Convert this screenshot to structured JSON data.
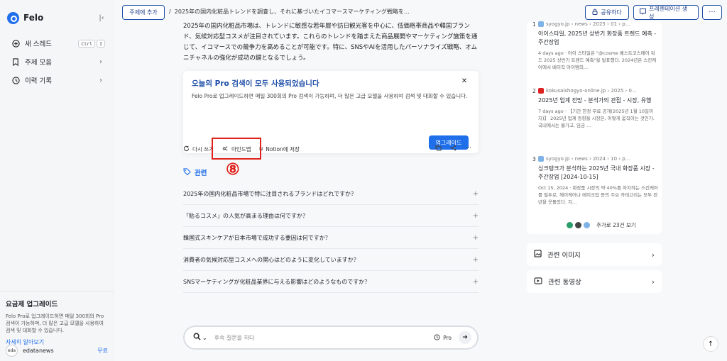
{
  "app": {
    "name": "Felo"
  },
  "sidebar": {
    "items": [
      {
        "label": "새 스레드",
        "shortcut": [
          "Ctrl",
          "I"
        ]
      },
      {
        "label": "주제 모음"
      },
      {
        "label": "이력 기록"
      }
    ],
    "upgrade": {
      "title": "요금제 업그레이드",
      "description": "Felo Pro로 업그레이드하면 매일 300회의 Pro 검색이 가능하며, 더 많은 고급 모델을 사용하여 검색 및 대화할 수 있습니다.",
      "learn_more": "자세히 알아보기"
    },
    "user": {
      "avatar": "eda",
      "name": "edatanews",
      "plan": "무료"
    }
  },
  "topbar": {
    "add_topic": "주제에 추가",
    "title": "2025年の国内化粧品トレンドを調査し、それに基づいたイコマースマーケティング戦略を提...",
    "share": "공유하다",
    "presentation": "프레젠테이션 생성",
    "more": "···"
  },
  "answer": {
    "text": "2025年の国内化粧品市場は、トレンドに敏感な若年層や訪日観光客を中心に、低価格帯商品や韓国ブランド、気候対応型コスメが注目されています。これらのトレンドを踏まえた商品展開やマーケティング施策を通じて、イコマースでの競争力を高めることが可能です。特に、SNSやAIを活用したパーソナライズ戦略、オムニチャネルの強化が成功の鍵となるでしょう。"
  },
  "pro_notice": {
    "title": "오늘의 Pro 검색이 모두 사용되었습니다",
    "description": "Felo Pro로 업그레이드하면 매일 300회의 Pro 검색이 가능하며, 더 많은 고급 모델을 사용하여 검색 및 대화할 수 있습니다.",
    "upgrade": "업그레이드"
  },
  "actions": {
    "retry": "다시 쓰기",
    "mindmap": "마인드맵",
    "notion": "Notion에 저장",
    "annotation_number": "⑧"
  },
  "related": {
    "heading": "관련",
    "questions": [
      "2025年の国内化粧品市場で特に注目されるブランドはどれですか？",
      "「貼るコスメ」の人気が高まる理由は何ですか？",
      "韓国式スキンケアが日本市場で成功する要因は何ですか？",
      "消費者の気候対応型コスメへの関心はどのように変化していますか？",
      "SNSマーケティングが化粧品業界に与える影響はどのようなものですか？"
    ]
  },
  "ask": {
    "placeholder": "후속 질문을 하다",
    "mode": "Pro"
  },
  "sources": {
    "items": [
      {
        "num": "1",
        "site": "syogyo.jp › news › 2025 › 01 › p...",
        "title": "아이스타일, 2025년 상반기 화장품 트렌드 예측 - 주간장업",
        "snippet": "4 days ago · 아이 스타일은 \"@cosme 베스트코스메어 워드 2025 상반기 트렌드 예측\"을 발표했다. 2024년은 스킨케어에서 베이직 아이템의..."
      },
      {
        "num": "2",
        "site": "kokusaishogyo-online.jp › 2025 › 0...",
        "title": "2025년 업계 전망 - 분석가의 관점 - 시장, 유행",
        "snippet": "7 days ago · 【기간 한정 무료 공개(2025년 1월 10일까지)】 2025년 업계 동향을 시장은, 어떻게 움직이는 것인가. 국내에서는 물가고, 임금 ..."
      },
      {
        "num": "3",
        "site": "syogyo.jp › news › 2024 › 10 › p...",
        "title": "싱크탱크가 분석하는 2025년 국내 화장품 시장 - 주간장업 [2024-10-15]",
        "snippet": "Oct 15, 2024 · 화장품 시장의 약 40%를 차지하는 스킨케어를 필두로, 헤어케어나 메이크업 등의 주요 카테고리는 모두 전년을 웃돌았다. 지..."
      }
    ],
    "more": "추가로 23건 보기"
  },
  "right_cards": {
    "images": "관련 이미지",
    "videos": "관련 동영상"
  },
  "colors": {
    "accent": "#1f6feb",
    "highlight": "#e0201a"
  }
}
